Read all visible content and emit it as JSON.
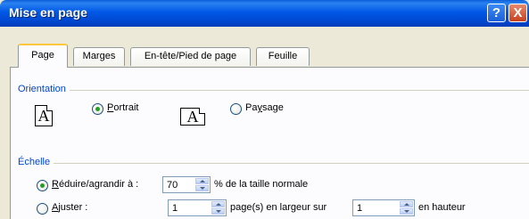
{
  "window": {
    "title": "Mise en page",
    "help_label": "?",
    "close_label": "X"
  },
  "tabs": [
    {
      "label": "Page",
      "active": true
    },
    {
      "label": "Marges",
      "active": false
    },
    {
      "label": "En-tête/Pied de page",
      "active": false
    },
    {
      "label": "Feuille",
      "active": false
    }
  ],
  "orientation": {
    "section_label": "Orientation",
    "icon_letter": "A",
    "portrait": {
      "label_first": "P",
      "label_rest": "ortrait",
      "selected": true
    },
    "paysage": {
      "label_first": "Pa",
      "label_underlined": "y",
      "label_rest": "sage",
      "selected": false
    }
  },
  "echelle": {
    "section_label": "Échelle",
    "reduire": {
      "label_underlined": "R",
      "label_rest": "éduire/agrandir à :",
      "selected": true,
      "value": "70",
      "suffix": "% de la taille normale"
    },
    "ajuster": {
      "label_underlined": "A",
      "label_rest": "juster :",
      "selected": false,
      "width_value": "1",
      "width_suffix": "page(s) en largeur sur",
      "height_value": "1",
      "height_suffix": "en hauteur"
    }
  },
  "colors": {
    "titlebar": "#0054e3",
    "section_label": "#0046d5",
    "radio_selected": "#21a121",
    "dialog_bg": "#ece9d8"
  }
}
